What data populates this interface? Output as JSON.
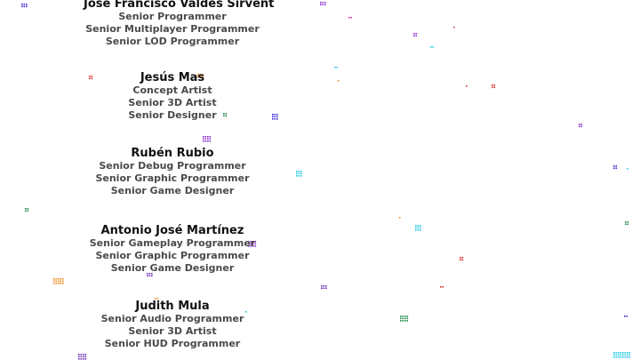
{
  "credits": [
    {
      "name": "Jose Francisco Valdés Sirvent",
      "roles": [
        "Senior Programmer",
        "Senior Multiplayer Programmer",
        "Senior LOD Programmer"
      ]
    },
    {
      "name": "Jesús Mas",
      "roles": [
        "Concept Artist",
        "Senior 3D Artist",
        "Senior Designer"
      ]
    },
    {
      "name": "Rubén Rubio",
      "roles": [
        "Senior Debug Programmer",
        "Senior Graphic Programmer",
        "Senior Game Designer"
      ]
    },
    {
      "name": "Antonio José Martínez",
      "roles": [
        "Senior Gameplay Programmer",
        "Senior Graphic Programmer",
        "Senior Game Designer"
      ]
    },
    {
      "name": "Judith Mula",
      "roles": [
        "Senior Audio Programmer",
        "Senior 3D Artist",
        "Senior HUD Programmer"
      ]
    }
  ],
  "particle_colors": [
    "#3b2bd6",
    "#e0339a",
    "#22c9e0",
    "#8b2ad1",
    "#d62a2a",
    "#f08a1c",
    "#1a8a4a",
    "#6b2fb8",
    "#2a7bd6"
  ]
}
